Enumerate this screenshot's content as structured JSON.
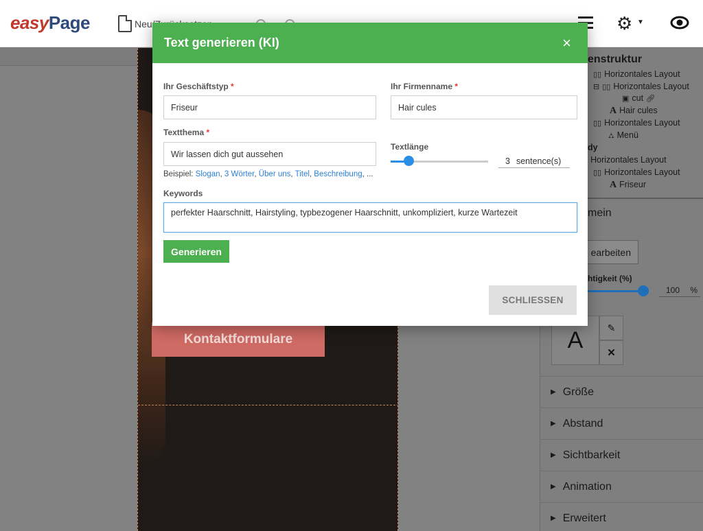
{
  "toolbar": {
    "logo_easy": "easy",
    "logo_page": "Page",
    "new_reset_label": "Neu/Zurücksetzen"
  },
  "canvas": {
    "contact_button_label": "Kontaktformulare"
  },
  "structure_panel": {
    "title": "Seitenstruktur",
    "title_visible": "enstruktur",
    "items": [
      "Horizontales Layout",
      "Horizontales Layout",
      "cut",
      "Hair cules",
      "Horizontales Layout",
      "Menü",
      "dy",
      "Horizontales Layout",
      "Horizontales Layout",
      "Friseur"
    ]
  },
  "props_panel": {
    "section_title_visible": "mein",
    "edit_button_visible": "earbeiten",
    "opacity_label_visible": "htigkeit (%)",
    "opacity_value": "100",
    "opacity_unit": "%",
    "font_preview": "A",
    "accordions": [
      "Größe",
      "Abstand",
      "Sichtbarkeit",
      "Animation",
      "Erweitert"
    ]
  },
  "modal": {
    "title": "Text generieren (KI)",
    "close_icon": "×",
    "business_type": {
      "label": "Ihr Geschäftstyp",
      "value": "Friseur"
    },
    "company_name": {
      "label": "Ihr Firmenname",
      "value": "Hair cules"
    },
    "text_topic": {
      "label": "Textthema",
      "value": "Wir lassen dich gut aussehen"
    },
    "examples_prefix": "Beispiel:",
    "examples": [
      "Slogan",
      "3 Wörter",
      "Über uns",
      "Titel",
      "Beschreibung"
    ],
    "examples_suffix": "...",
    "text_length": {
      "label": "Textlänge",
      "value": "3",
      "unit": "sentence(s)",
      "fraction": 0.18
    },
    "keywords": {
      "label": "Keywords",
      "value": "perfekter Haarschnitt, Hairstyling, typbezogener Haarschnitt, unkompliziert, kurze Wartezeit"
    },
    "generate_label": "Generieren",
    "close_label": "SCHLIESSEN",
    "required_mark": "*"
  },
  "colors": {
    "accent_green": "#4caf50",
    "link_blue": "#2a7fd4",
    "slider_blue": "#2a8ee6",
    "required_red": "#e53935"
  }
}
